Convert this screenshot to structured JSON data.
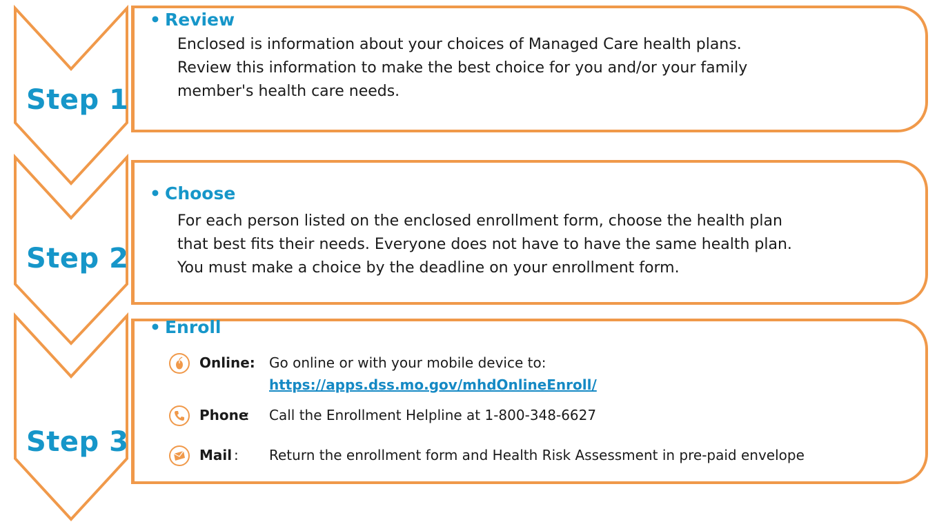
{
  "colors": {
    "accent_orange": "#f0994a",
    "heading_blue": "#1696c9",
    "link_blue": "#1589c4"
  },
  "steps": [
    {
      "label": "Step 1",
      "title": "Review",
      "paragraphs": [
        "Enclosed is information about your choices of Managed Care health plans.",
        "Review this information to make the best choice for you and/or your family",
        "member's health care needs."
      ]
    },
    {
      "label": "Step 2",
      "title": "Choose",
      "paragraphs": [
        "For each person listed on the enclosed enrollment form, choose the health plan",
        "that best fits their needs. Everyone does not have to have the same health plan.",
        "You must make a choice by the deadline on your enrollment form."
      ]
    },
    {
      "label": "Step 3",
      "title": "Enroll",
      "methods": [
        {
          "icon": "mouse-icon",
          "label": "Online:",
          "text": "Go online or with your mobile device to:",
          "link": "https://apps.dss.mo.gov/mhdOnlineEnroll/"
        },
        {
          "icon": "phone-icon",
          "label": "Phone",
          "colon": ":",
          "text": "Call the Enrollment Helpline at 1-800-348-6627"
        },
        {
          "icon": "envelope-icon",
          "label": "Mail",
          "colon": ":",
          "text": "Return the enrollment form and Health Risk Assessment in pre-paid envelope"
        }
      ]
    }
  ]
}
